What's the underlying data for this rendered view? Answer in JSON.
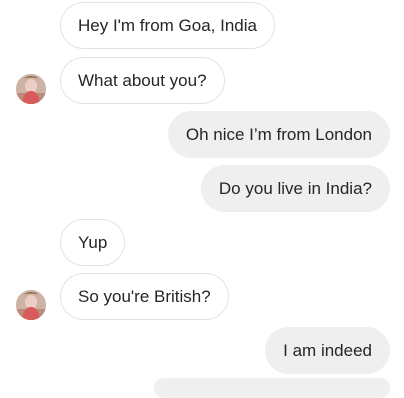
{
  "messages": [
    {
      "side": "in",
      "text": "Hey I'm from Goa, India"
    },
    {
      "side": "in",
      "text": "What about you?"
    },
    {
      "side": "out",
      "text": "Oh nice I’m from London"
    },
    {
      "side": "out",
      "text": "Do you live in India?"
    },
    {
      "side": "in",
      "text": "Yup"
    },
    {
      "side": "in",
      "text": "So you're British?"
    },
    {
      "side": "out",
      "text": "I am indeed"
    }
  ],
  "colors": {
    "incoming_bg": "#ffffff",
    "incoming_border": "#e3e3e3",
    "outgoing_bg": "#efefef",
    "text": "#262626"
  },
  "icons": {
    "avatar": "avatar-photo"
  }
}
